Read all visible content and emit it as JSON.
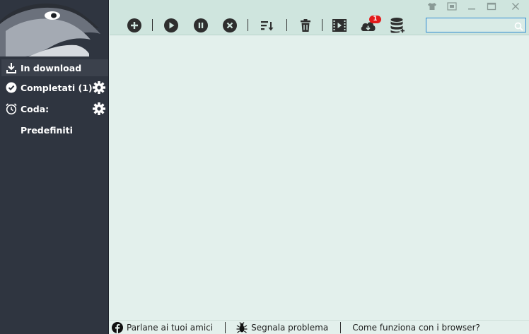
{
  "sidebar": {
    "items": [
      {
        "label": "In download",
        "icon": "download-icon",
        "active": true
      },
      {
        "label": "Completati (1)",
        "icon": "check-circle-icon",
        "gear": true
      },
      {
        "label": "Coda:",
        "icon": "alarm-clock-icon",
        "gear": true
      },
      {
        "label": "Predefiniti",
        "icon": ""
      }
    ]
  },
  "toolbar": {
    "buttons": [
      "add-icon",
      "play-icon",
      "pause-icon",
      "stop-icon",
      "sort-icon",
      "delete-icon",
      "video-icon",
      "cloud-icon",
      "database-icon"
    ],
    "cloud_badge": "1"
  },
  "search": {
    "value": "",
    "placeholder": ""
  },
  "footer": {
    "share_label": "Parlane ai tuoi amici",
    "report_label": "Segnala problema",
    "browser_label": "Come funziona con i browser?"
  },
  "colors": {
    "sidebar_bg": "#2f3540",
    "toolbar_bg": "#cfe5de",
    "main_bg": "#e3f0ec",
    "badge": "#e31b1b",
    "search_border": "#2f8bd2"
  }
}
